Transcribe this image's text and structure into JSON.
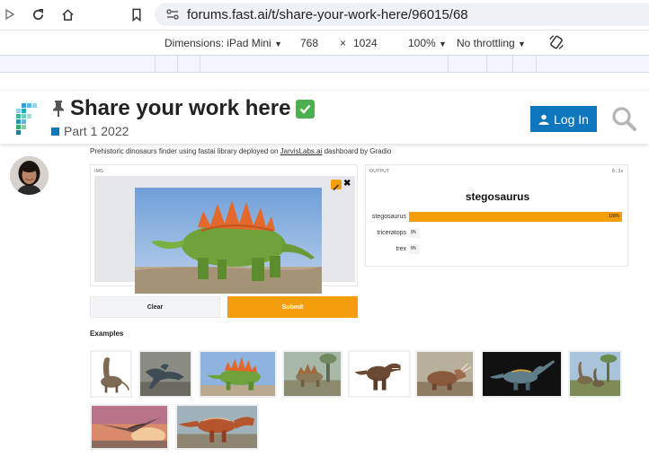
{
  "browser": {
    "url": "forums.fast.ai/t/share-your-work-here/96015/68"
  },
  "devtools": {
    "dimensions_label": "Dimensions: iPad Mini",
    "width": "768",
    "times": "×",
    "height": "1024",
    "zoom": "100%",
    "throttling": "No throttling"
  },
  "topic": {
    "title": "Share your work here",
    "category": "Part 1 2022",
    "category_color": "#0e76bd"
  },
  "header": {
    "login_label": "Log In",
    "accent": "#0e76bd"
  },
  "post": {
    "caption_before": "Prehistoric dinosaurs finder using fastai library deployed on ",
    "caption_link": "JarvisLabs.ai",
    "caption_after": " dashboard by Gradio"
  },
  "app": {
    "input_label": "IMG",
    "output_label": "OUTPUT",
    "elapsed": "0.3s",
    "prediction": "stegosaurus",
    "confidences": [
      {
        "label": "stegosaurus",
        "value": 1.0,
        "text": "100%"
      },
      {
        "label": "triceratops",
        "value": 0.0,
        "text": "0%"
      },
      {
        "label": "trex",
        "value": 0.0,
        "text": "0%"
      }
    ],
    "clear_label": "Clear",
    "submit_label": "Submit",
    "examples_label": "Examples",
    "accent": "#f59e0b"
  }
}
